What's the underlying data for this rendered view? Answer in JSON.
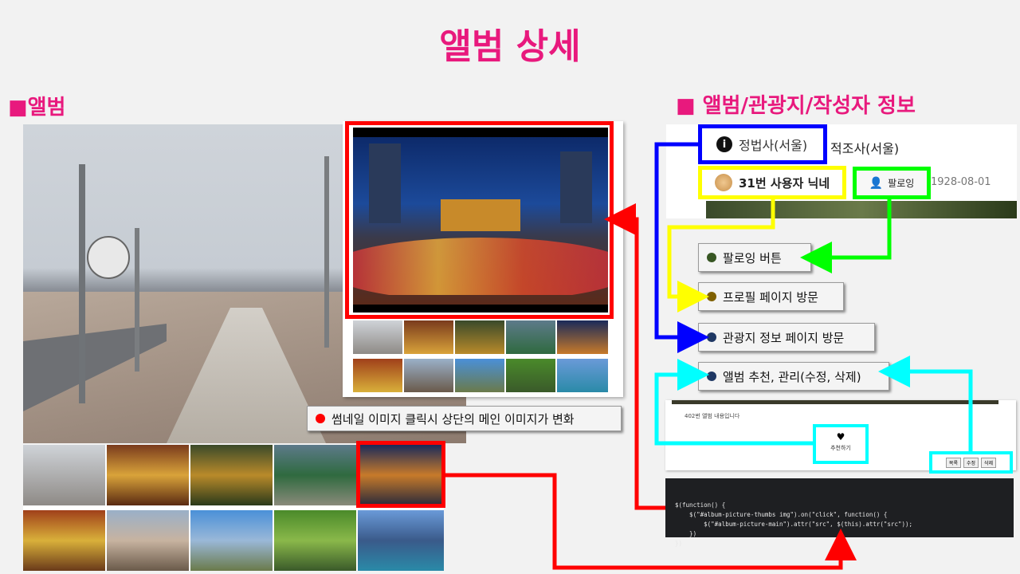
{
  "page": {
    "title": "앨범 상세",
    "section_album": "■앨범",
    "section_info": "■ 앨범/관광지/작성자 정보"
  },
  "info_panel": {
    "place_name": "정법사(서울)",
    "place_name2": "적조사(서울)",
    "user_name": "31번 사용자 닉네",
    "follow_button": "팔로잉",
    "date": "1928-08-01",
    "album_text": "402번 앨범 내용입니다",
    "recommend_button": "추천하기",
    "manage_buttons": [
      "목록",
      "수정",
      "삭제"
    ]
  },
  "callouts": {
    "thumb_click": "썸네일 이미지 클릭시 상단의 메인 이미지가 변화",
    "follow": "팔로잉 버튼",
    "profile": "프로필 페이지 방문",
    "tour": "관광지 정보 페이지 방문",
    "album": "앨범 추천, 관리(수정, 삭제)"
  },
  "code": {
    "lines": [
      "$(function() {",
      "    $(\"#album-picture-thumbs img\").on(\"click\", function() {",
      "        $(\"#album-picture-main\").attr(\"src\", $(this).attr(\"src\"));",
      "    })",
      "})"
    ]
  },
  "colors": {
    "accent": "#e8197d",
    "red": "#ff0000",
    "blue": "#0000ff",
    "yellow": "#ffff00",
    "green": "#00ff00",
    "cyan": "#00ffff",
    "dot_follow": "#375623",
    "dot_profile": "#7f6000",
    "dot_nav": "#1f3864"
  }
}
